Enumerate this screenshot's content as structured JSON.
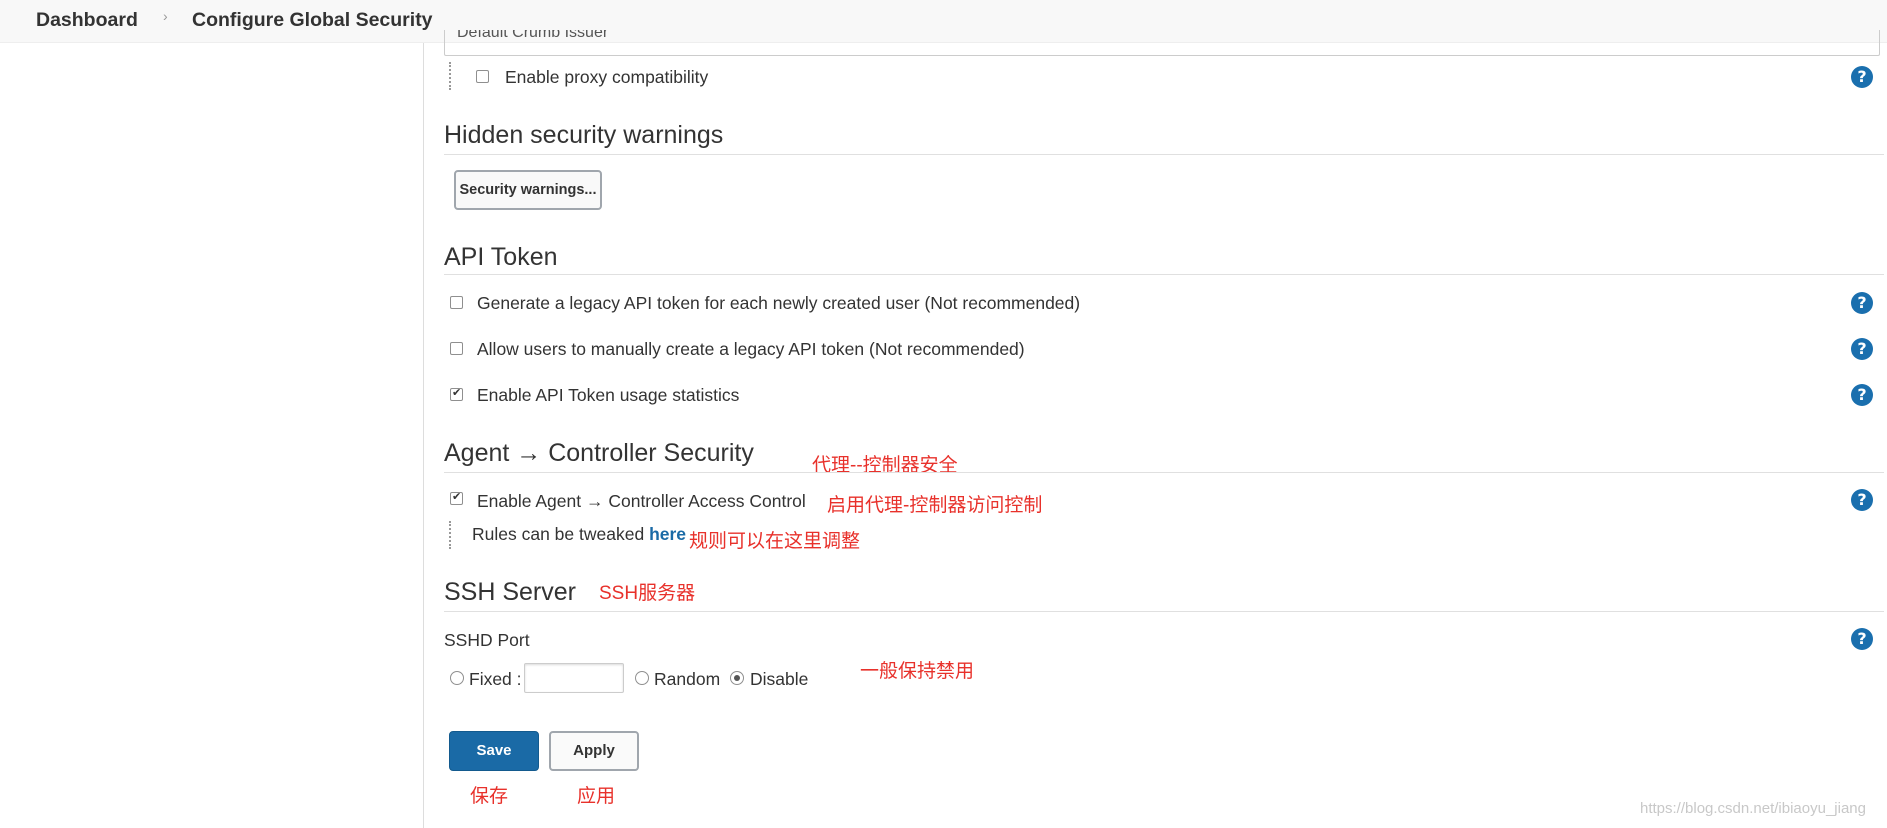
{
  "breadcrumb": {
    "items": [
      "Dashboard",
      "Configure Global Security"
    ],
    "separator": "›"
  },
  "top_field": {
    "value": "Default Crumb Issuer"
  },
  "proxy": {
    "label": "Enable proxy compatibility",
    "checked": false
  },
  "hidden_warnings": {
    "title": "Hidden security warnings",
    "button": "Security warnings..."
  },
  "api_token": {
    "title": "API Token",
    "options": [
      {
        "label": "Generate a legacy API token for each newly created user (Not recommended)",
        "checked": false
      },
      {
        "label": "Allow users to manually create a legacy API token (Not recommended)",
        "checked": false
      },
      {
        "label": "Enable API Token usage statistics",
        "checked": true
      }
    ]
  },
  "agent": {
    "title": "Agent → Controller Security",
    "enable_label": "Enable Agent → Controller Access Control",
    "enable_checked": true,
    "rules_text": "Rules can be tweaked",
    "rules_link": "here"
  },
  "ssh": {
    "title": "SSH Server",
    "port_label": "SSHD Port",
    "fixed_label": "Fixed :",
    "fixed_value": "",
    "random_label": "Random",
    "disable_label": "Disable",
    "selected": "Disable"
  },
  "actions": {
    "save": "Save",
    "apply": "Apply"
  },
  "annotations": {
    "agent_title": "代理--控制器安全",
    "agent_enable": "启用代理-控制器访问控制",
    "rules": "规则可以在这里调整",
    "ssh_title": "SSH服务器",
    "ssh_disable": "一般保持禁用",
    "save": "保存",
    "apply": "应用"
  },
  "help_icon": "?",
  "watermark": "https://blog.csdn.net/ibiaoyu_jiang",
  "colors": {
    "accent": "#1a6aa6",
    "annotation": "#e8312b"
  }
}
